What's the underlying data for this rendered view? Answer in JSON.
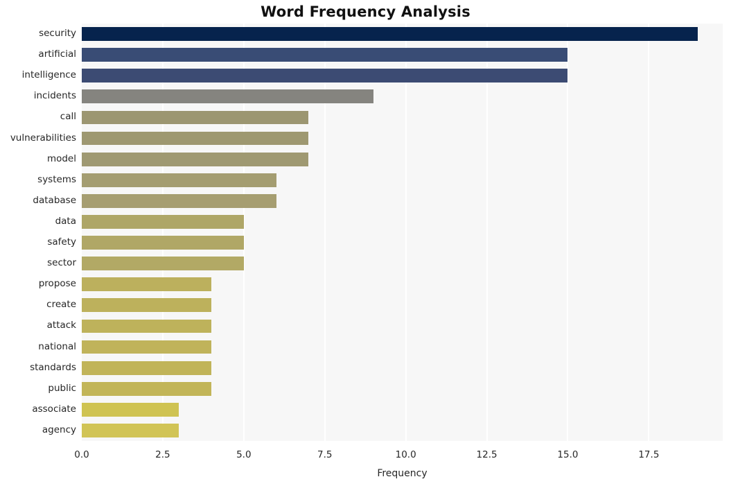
{
  "chart_data": {
    "type": "bar",
    "orientation": "horizontal",
    "title": "Word Frequency Analysis",
    "xlabel": "Frequency",
    "ylabel": "",
    "categories": [
      "security",
      "artificial",
      "intelligence",
      "incidents",
      "call",
      "vulnerabilities",
      "model",
      "systems",
      "database",
      "data",
      "safety",
      "sector",
      "propose",
      "create",
      "attack",
      "national",
      "standards",
      "public",
      "associate",
      "agency"
    ],
    "values": [
      19,
      15,
      15,
      9,
      7,
      7,
      7,
      6,
      6,
      5,
      5,
      5,
      4,
      4,
      4,
      4,
      4,
      4,
      3,
      3
    ],
    "bar_colors": [
      "#06234d",
      "#394c75",
      "#3c4b73",
      "#85847f",
      "#9c9671",
      "#9e9871",
      "#9f9972",
      "#a49d71",
      "#a69e71",
      "#aea667",
      "#b0a766",
      "#b2a965",
      "#bcb05d",
      "#bdb15c",
      "#beb25b",
      "#c0b35a",
      "#c1b459",
      "#c2b558",
      "#cfc352",
      "#d1c456"
    ],
    "xlim": [
      0.0,
      19.78
    ],
    "ylim_count": 20,
    "xticks": [
      "0.0",
      "2.5",
      "5.0",
      "7.5",
      "10.0",
      "12.5",
      "15.0",
      "17.5"
    ],
    "xtick_values": [
      0.0,
      2.5,
      5.0,
      7.5,
      10.0,
      12.5,
      15.0,
      17.5
    ],
    "grid": true,
    "grid_axis": "x",
    "grid_color": "#ffffff",
    "plot_background": "#f7f7f7",
    "figure_background": "#ffffff",
    "legend": null,
    "legend_position": "none"
  }
}
